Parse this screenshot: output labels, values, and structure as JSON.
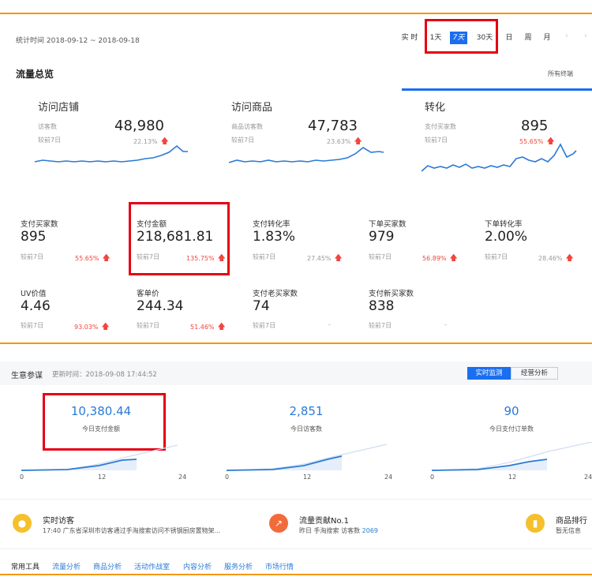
{
  "header": {
    "date_range": "统计时间 2018-09-12 ~ 2018-09-18",
    "ranges": [
      "实 时",
      "1天",
      "7天",
      "30天",
      "日",
      "周",
      "月"
    ],
    "selected_range": "7天"
  },
  "overview": {
    "title": "流量总览",
    "terminal_select": "所有终端",
    "cards": [
      {
        "title": "访问店铺",
        "label": "访客数",
        "value": "48,980",
        "compare": "较前7日",
        "pct": "22.13%"
      },
      {
        "title": "访问商品",
        "label": "商品访客数",
        "value": "47,783",
        "compare": "较前7日",
        "pct": "23.63%"
      },
      {
        "title": "转化",
        "label": "支付买家数",
        "value": "895",
        "compare": "较前7日",
        "pct": "55.65%"
      }
    ],
    "metrics": [
      {
        "label": "支付买家数",
        "value": "895",
        "compare": "较前7日",
        "pct": "55.65%"
      },
      {
        "label": "支付金额",
        "value": "218,681.81",
        "compare": "较前7日",
        "pct": "135.75%"
      },
      {
        "label": "支付转化率",
        "value": "1.83%",
        "compare": "较前7日",
        "pct": "27.45%"
      },
      {
        "label": "下单买家数",
        "value": "979",
        "compare": "较前7日",
        "pct": "56.89%"
      },
      {
        "label": "下单转化率",
        "value": "2.00%",
        "compare": "较前7日",
        "pct": "28.46%"
      },
      {
        "label": "UV价值",
        "value": "4.46",
        "compare": "较前7日",
        "pct": "93.03%"
      },
      {
        "label": "客单价",
        "value": "244.34",
        "compare": "较前7日",
        "pct": "51.46%"
      },
      {
        "label": "支付老买家数",
        "value": "74",
        "compare": "较前7日",
        "pct": "-"
      },
      {
        "label": "支付新买家数",
        "value": "838",
        "compare": "较前7日",
        "pct": "-"
      }
    ]
  },
  "business": {
    "title": "生意参谋",
    "updated": "更新时间：2018-09-08 17:44:52",
    "tabs": [
      "实时监测",
      "经营分析"
    ],
    "stats": [
      {
        "value": "10,380.44",
        "label": "今日支付金额"
      },
      {
        "value": "2,851",
        "label": "今日访客数"
      },
      {
        "value": "90",
        "label": "今日支付订单数"
      }
    ],
    "axis": [
      "0",
      "12",
      "24"
    ]
  },
  "feed": {
    "items": [
      {
        "title": "实时访客",
        "text": "17:40 广东省深圳市访客通过手淘搜索访问不锈钢厨房置物架..."
      },
      {
        "title": "流量贡献No.1",
        "text": "昨日 手淘搜索 访客数",
        "count": "2069"
      },
      {
        "title": "商品排行",
        "text": "暂无信息"
      }
    ]
  },
  "tools": {
    "title": "常用工具",
    "links": [
      "流量分析",
      "商品分析",
      "活动作战室",
      "内容分析",
      "服务分析",
      "市场行情"
    ]
  },
  "colors": {
    "accent": "#1a6ef0",
    "link": "#2a7ad5",
    "up": "#f2453d",
    "frame": "#f39800",
    "highlight": "#e60012"
  }
}
